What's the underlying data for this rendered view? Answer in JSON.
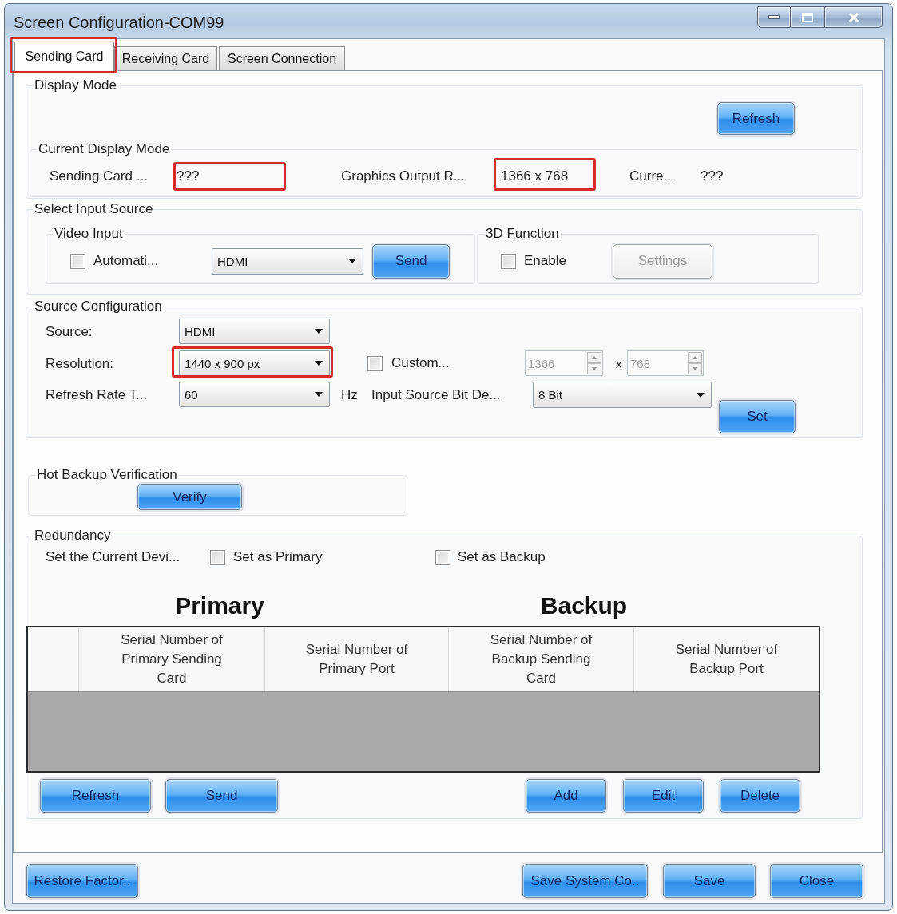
{
  "window": {
    "title": "Screen Configuration-COM99"
  },
  "tabs": [
    {
      "label": "Sending Card",
      "selected": true,
      "highlighted": true
    },
    {
      "label": "Receiving Card",
      "selected": false,
      "highlighted": false
    },
    {
      "label": "Screen Connection",
      "selected": false,
      "highlighted": false
    }
  ],
  "display_mode": {
    "title": "Display Mode",
    "refresh_button": "Refresh",
    "current": {
      "title": "Current Display Mode",
      "fields": [
        {
          "label": "Sending Card ...",
          "value": "???",
          "highlighted": true
        },
        {
          "label": "Graphics Output R...",
          "value": "1366 x 768",
          "highlighted": true
        },
        {
          "label": "Curre...",
          "value": "???",
          "highlighted": false
        }
      ]
    }
  },
  "select_input_source": {
    "title": "Select Input Source",
    "video_input": {
      "title": "Video Input",
      "auto_checkbox": {
        "label": "Automati...",
        "checked": false
      },
      "dropdown": "HDMI",
      "send_button": "Send"
    },
    "function_3d": {
      "title": "3D Function",
      "enable_checkbox": {
        "label": "Enable",
        "checked": false
      },
      "settings_button": {
        "label": "Settings",
        "disabled": true
      }
    }
  },
  "source_configuration": {
    "title": "Source Configuration",
    "source": {
      "label": "Source:",
      "value": "HDMI"
    },
    "resolution": {
      "label": "Resolution:",
      "value": "1440 x 900 px",
      "highlighted": true
    },
    "custom_checkbox": {
      "label": "Custom...",
      "checked": false
    },
    "width_spinner": {
      "value": "1366",
      "disabled": true
    },
    "times_sign": "x",
    "height_spinner": {
      "value": "768",
      "disabled": true
    },
    "refresh_rate": {
      "label": "Refresh Rate T...",
      "value": "60",
      "unit": "Hz"
    },
    "bit_depth": {
      "label": "Input Source Bit De...",
      "value": "8 Bit"
    },
    "set_button": "Set"
  },
  "hot_backup": {
    "title": "Hot Backup Verification",
    "verify_button": "Verify"
  },
  "redundancy": {
    "title": "Redundancy",
    "device_label": "Set the Current Devi...",
    "checkboxes": [
      {
        "label": "Set as Primary",
        "checked": false
      },
      {
        "label": "Set as Backup",
        "checked": false
      }
    ],
    "headings": [
      "Primary",
      "Backup"
    ],
    "table": {
      "columns": [
        "Serial Number of Primary Sending Card",
        "Serial Number of Primary Port",
        "Serial Number of Backup Sending Card",
        "Serial Number of Backup Port"
      ]
    },
    "left_buttons": [
      "Refresh",
      "Send"
    ],
    "right_buttons": [
      "Add",
      "Edit",
      "Delete"
    ]
  },
  "footer": {
    "left_buttons": [
      "Restore Factor.."
    ],
    "right_buttons": [
      "Save System Co..",
      "Save",
      "Close"
    ]
  }
}
